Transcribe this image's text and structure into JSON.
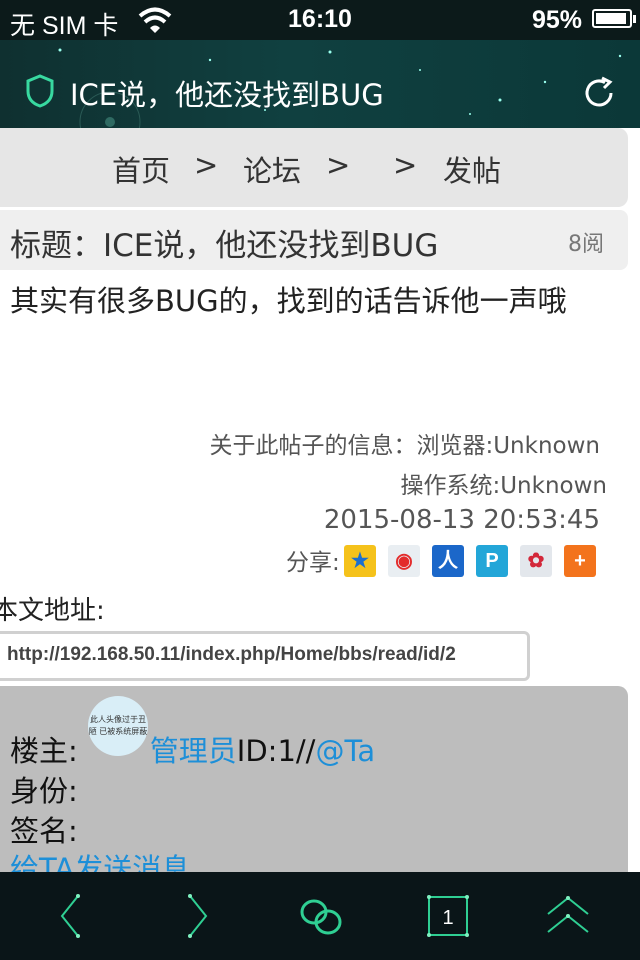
{
  "statusbar": {
    "carrier": "无 SIM 卡",
    "time": "16:10",
    "battery": "95%"
  },
  "browser": {
    "page_title": "ICE说，他还没找到BUG"
  },
  "breadcrumb": {
    "home": "首页",
    "sep1": ">",
    "forum": "论坛",
    "sep2": ">",
    "sep3": ">",
    "post": "发帖"
  },
  "post": {
    "title": "标题：ICE说，他还没找到BUG",
    "views": "8阅",
    "content": "其实有很多BUG的，找到的话告诉他一声哦",
    "info_label": "关于此帖子的信息：",
    "browser_info": "浏览器:Unknown",
    "os_info": "操作系统:Unknown",
    "date": "2015-08-13 20:53:45",
    "share_label": "分享:",
    "address_label": "本文地址:",
    "address_value": "http://192.168.50.11/index.php/Home/bbs/read/id/2"
  },
  "owner": {
    "label": "楼主:",
    "avatar_text": "此人头像过于丑陋 已被系统屏蔽",
    "name": "管理员",
    "id_text": "ID:1//",
    "at": "@Ta",
    "identity": "身份:",
    "signature": "签名:",
    "message": "给TA发送消息"
  },
  "toolbar": {
    "tab_count": "1"
  }
}
